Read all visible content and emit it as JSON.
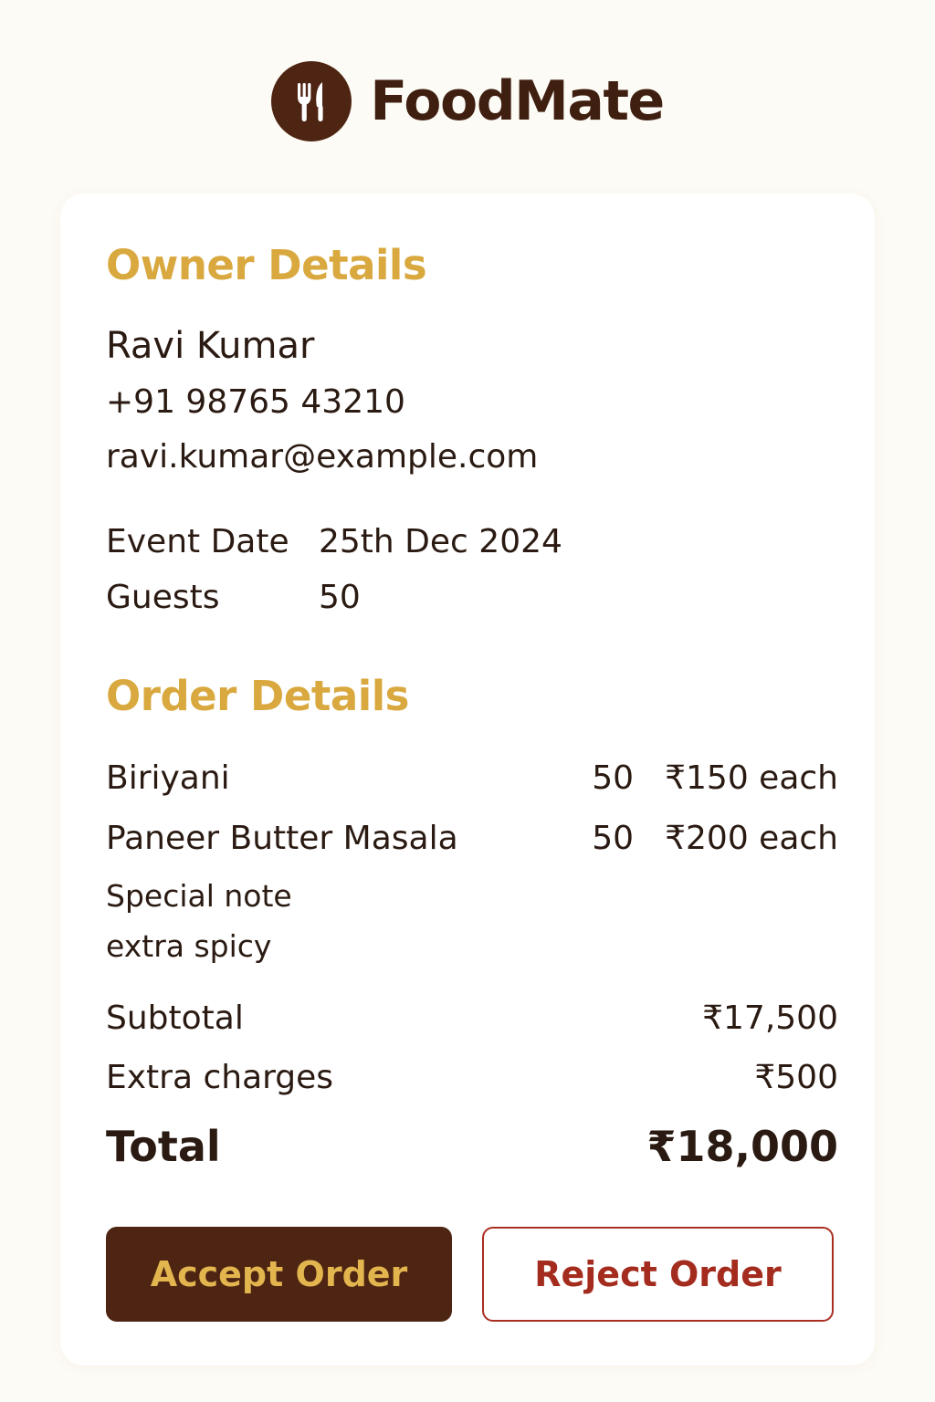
{
  "app": {
    "name": "FoodMate",
    "logo_icon": "fork-knife-icon"
  },
  "owner": {
    "title": "Owner Details",
    "name": "Ravi Kumar",
    "phone": "+91 98765 43210",
    "email": "ravi.kumar@example.com",
    "event_date_label": "Event Date",
    "event_date_value": "25th Dec 2024",
    "guests_label": "Guests",
    "guests_value": "50"
  },
  "order": {
    "title": "Order Details",
    "items": [
      {
        "name": "Biriyani",
        "qty": "50",
        "price": "₹150 each"
      },
      {
        "name": "Paneer Butter Masala",
        "qty": "50",
        "price": "₹200 each"
      }
    ],
    "note_label": "Special note",
    "note_value": "extra spicy"
  },
  "summary": {
    "subtotal_label": "Subtotal",
    "subtotal_value": "₹17,500",
    "extra_label": "Extra charges",
    "extra_value": "₹500",
    "total_label": "Total",
    "total_value": "₹18,000"
  },
  "actions": {
    "accept_label": "Accept Order",
    "reject_label": "Reject Order"
  },
  "colors": {
    "brand_brown": "#4e2412",
    "accent_gold": "#d9a83e",
    "reject_red": "#a42c1e",
    "page_background": "#fdfbf5"
  }
}
